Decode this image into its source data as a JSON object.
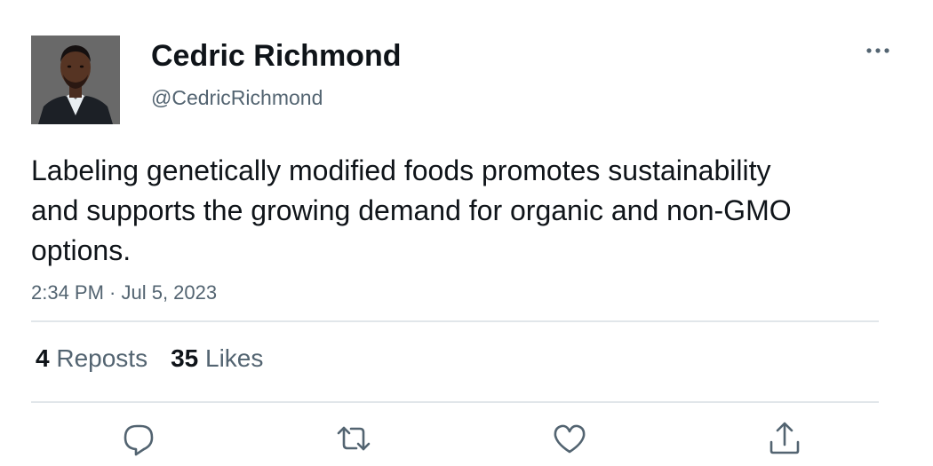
{
  "author": {
    "display_name": "Cedric Richmond",
    "handle": "@CedricRichmond"
  },
  "tweet": {
    "text": "Labeling genetically modified foods promotes sustainability and supports the growing demand for organic and non-GMO options.",
    "timestamp": "2:34 PM · Jul 5, 2023"
  },
  "stats": {
    "reposts_count": "4",
    "reposts_label": "Reposts",
    "likes_count": "35",
    "likes_label": "Likes"
  },
  "icons": {
    "more": "more-horizontal-icon",
    "reply": "reply-icon",
    "repost": "repost-icon",
    "like": "heart-icon",
    "share": "share-icon"
  },
  "colors": {
    "text_primary": "#0f1419",
    "text_secondary": "#536471",
    "divider": "#e1e6ea"
  }
}
